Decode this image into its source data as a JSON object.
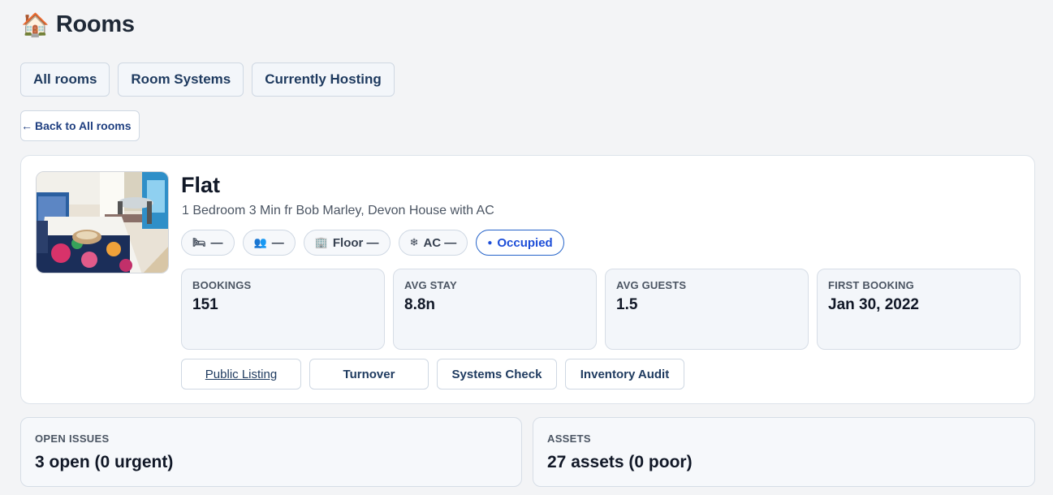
{
  "page": {
    "title": "Rooms",
    "icon": "house-icon",
    "icon_glyph": "🏠"
  },
  "tabs": [
    {
      "label": "All rooms"
    },
    {
      "label": "Room Systems"
    },
    {
      "label": "Currently Hosting"
    }
  ],
  "back": {
    "arrow": "←",
    "label": "Back to All rooms"
  },
  "room": {
    "title": "Flat",
    "subtitle": "1 Bedroom 3 Min fr Bob Marley, Devon House with AC",
    "photo_icon": "room-photo",
    "chips": [
      {
        "icon": "bed-icon",
        "glyph": "🛏",
        "text": "—"
      },
      {
        "icon": "guests-icon",
        "glyph": "👥",
        "text": "—"
      },
      {
        "icon": "building-icon",
        "glyph": "🏢",
        "text": "Floor —"
      },
      {
        "icon": "snowflake-icon",
        "glyph": "❄",
        "text": "AC —"
      }
    ],
    "status": {
      "dot": "●",
      "text": "Occupied",
      "color": "#2563c9"
    },
    "stats": [
      {
        "label": "BOOKINGS",
        "value": "151"
      },
      {
        "label": "AVG STAY",
        "value": "8.8n"
      },
      {
        "label": "AVG GUESTS",
        "value": "1.5"
      },
      {
        "label": "FIRST BOOKING",
        "value": "Jan 30, 2022"
      }
    ],
    "actions": [
      {
        "label": "Public Listing"
      },
      {
        "label": "Turnover"
      },
      {
        "label": "Systems Check"
      },
      {
        "label": "Inventory Audit"
      }
    ]
  },
  "summary": {
    "issues": {
      "label": "OPEN ISSUES",
      "value": "3 open (0 urgent)"
    },
    "assets": {
      "label": "ASSETS",
      "value": "27 assets (0 poor)"
    }
  }
}
